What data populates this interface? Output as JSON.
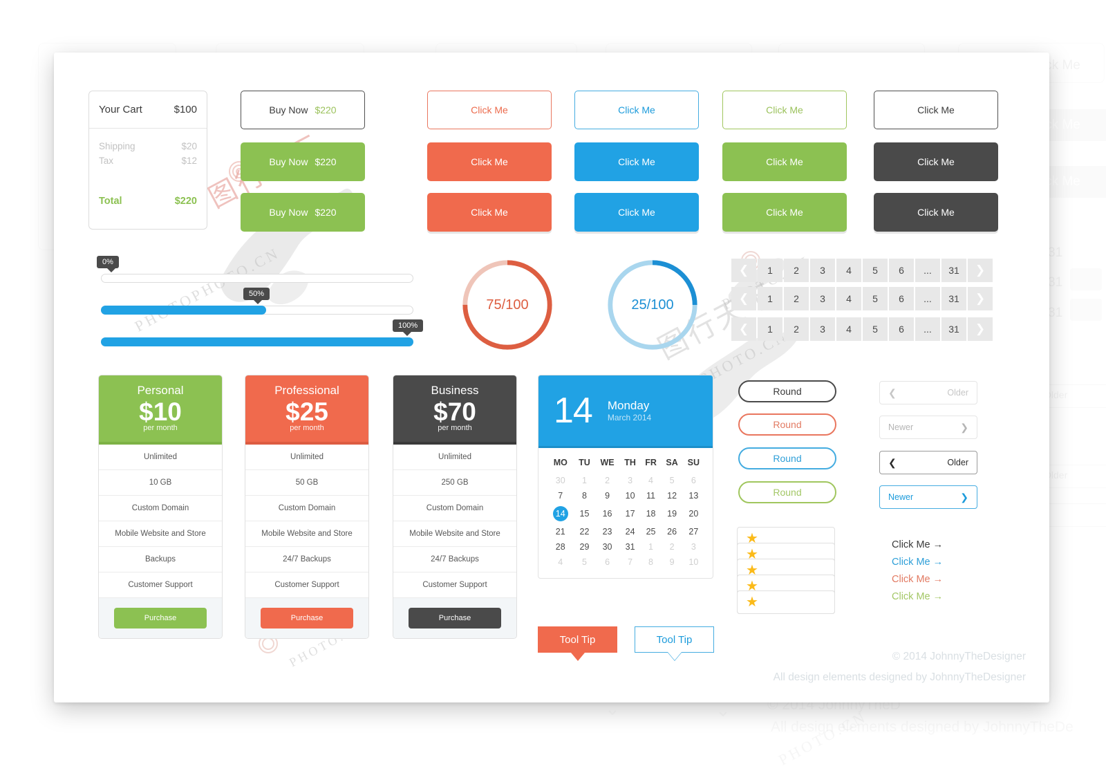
{
  "cart": {
    "title": "Your Cart",
    "total_amount": "$100",
    "rows": [
      {
        "label": "Shipping",
        "value": "$20"
      },
      {
        "label": "Tax",
        "value": "$12"
      }
    ],
    "total_label": "Total",
    "total_value": "$220"
  },
  "buy_buttons": [
    {
      "label": "Buy Now",
      "price": "$220",
      "style": "outline"
    },
    {
      "label": "Buy Now",
      "price": "$220",
      "style": "solid-green"
    },
    {
      "label": "Buy Now",
      "price": "$220",
      "style": "solid-green"
    }
  ],
  "click_buttons": {
    "label": "Click Me",
    "columns": [
      {
        "color_name": "red",
        "hex": "#F06A4D",
        "outline_text": "#EC6B4D"
      },
      {
        "color_name": "blue",
        "hex": "#21A2E4",
        "outline_text": "#1C9BDB"
      },
      {
        "color_name": "green",
        "hex": "#8CC152",
        "outline_text": "#9BC25C"
      },
      {
        "color_name": "dark",
        "hex": "#4A4A4A",
        "outline_text": "#3B3B3B"
      }
    ]
  },
  "sliders": [
    {
      "label": "0%",
      "value": 0
    },
    {
      "label": "50%",
      "value": 50
    },
    {
      "label": "100%",
      "value": 100
    }
  ],
  "donuts": [
    {
      "value": "75/100",
      "percent": 75,
      "color": "#DD5E41",
      "track": "#EFC5B9"
    },
    {
      "value": "25/100",
      "percent": 25,
      "color": "#1C8FD4",
      "track": "#A9D6EE"
    }
  ],
  "pagination": {
    "pages": [
      "1",
      "2",
      "3",
      "4",
      "5",
      "6",
      "...",
      "31"
    ],
    "prev_icon": "chevron-left-icon",
    "next_icon": "chevron-right-icon",
    "rows": [
      {
        "accent": "#4A4A4A"
      },
      {
        "accent": "#21A2E4"
      },
      {
        "accent": "#8CC152"
      }
    ]
  },
  "plans": [
    {
      "name": "Personal",
      "price": "$10",
      "per": "per month",
      "accent": "#8CC152",
      "features": [
        "Unlimited",
        "10 GB",
        "Custom Domain",
        "Mobile Website and Store",
        "Backups",
        "Customer Support"
      ],
      "cta": "Purchase"
    },
    {
      "name": "Professional",
      "price": "$25",
      "per": "per month",
      "accent": "#F06A4D",
      "features": [
        "Unlimited",
        "50 GB",
        "Custom Domain",
        "Mobile Website and Store",
        "24/7 Backups",
        "Customer Support"
      ],
      "cta": "Purchase"
    },
    {
      "name": "Business",
      "price": "$70",
      "per": "per month",
      "accent": "#4A4A4A",
      "features": [
        "Unlimited",
        "250 GB",
        "Custom Domain",
        "Mobile Website and Store",
        "24/7 Backups",
        "Customer Support"
      ],
      "cta": "Purchase"
    }
  ],
  "calendar": {
    "day": "14",
    "weekday": "Monday",
    "month_year": "March 2014",
    "weekday_headers": [
      "MO",
      "TU",
      "WE",
      "TH",
      "FR",
      "SA",
      "SU"
    ],
    "weeks": [
      [
        {
          "d": "30",
          "m": true
        },
        {
          "d": "1",
          "m": true
        },
        {
          "d": "2",
          "m": true
        },
        {
          "d": "3",
          "m": true
        },
        {
          "d": "4",
          "m": true
        },
        {
          "d": "5",
          "m": true
        },
        {
          "d": "6",
          "m": true
        }
      ],
      [
        {
          "d": "7"
        },
        {
          "d": "8"
        },
        {
          "d": "9"
        },
        {
          "d": "10"
        },
        {
          "d": "11"
        },
        {
          "d": "12"
        },
        {
          "d": "13"
        }
      ],
      [
        {
          "d": "14",
          "sel": true
        },
        {
          "d": "15"
        },
        {
          "d": "16"
        },
        {
          "d": "17"
        },
        {
          "d": "18"
        },
        {
          "d": "19"
        },
        {
          "d": "20"
        }
      ],
      [
        {
          "d": "21"
        },
        {
          "d": "22"
        },
        {
          "d": "23"
        },
        {
          "d": "24"
        },
        {
          "d": "25"
        },
        {
          "d": "26"
        },
        {
          "d": "27"
        }
      ],
      [
        {
          "d": "28"
        },
        {
          "d": "29"
        },
        {
          "d": "30"
        },
        {
          "d": "31"
        },
        {
          "d": "1",
          "m": true
        },
        {
          "d": "2",
          "m": true
        },
        {
          "d": "3",
          "m": true
        }
      ],
      [
        {
          "d": "4",
          "m": true
        },
        {
          "d": "5",
          "m": true
        },
        {
          "d": "6",
          "m": true
        },
        {
          "d": "7",
          "m": true
        },
        {
          "d": "8",
          "m": true
        },
        {
          "d": "9",
          "m": true
        },
        {
          "d": "10",
          "m": true
        }
      ]
    ]
  },
  "round_buttons": [
    {
      "label": "Round",
      "color": "#3B3B3B",
      "border": "#4A4A4A"
    },
    {
      "label": "Round",
      "color": "#E27A62",
      "border": "#E9765E"
    },
    {
      "label": "Round",
      "color": "#2E9FD8",
      "border": "#44ACE0"
    },
    {
      "label": "Round",
      "color": "#A3C766",
      "border": "#A0C65E"
    }
  ],
  "nav_buttons": [
    {
      "label": "Older",
      "dir": "prev",
      "text": "#c0c0c0",
      "border": "#e0e0e0",
      "chev": "chevron-left-icon"
    },
    {
      "label": "Newer",
      "dir": "next",
      "text": "#b5b5b5",
      "border": "#e0e0e0",
      "chev": "chevron-right-icon"
    },
    {
      "label": "Older",
      "dir": "prev",
      "text": "#2b2b2b",
      "border": "#9a9a9a",
      "chev": "chevron-left-icon"
    },
    {
      "label": "Newer",
      "dir": "next",
      "text": "#1C9BDB",
      "border": "#44ACE0",
      "chev": "chevron-right-icon"
    }
  ],
  "star_rows": [
    1,
    2,
    3,
    4,
    5
  ],
  "star_total": 5,
  "star_on_color": "#FBBA19",
  "star_off_color": "#E2E2E2",
  "arrow_links": [
    {
      "label": "Click Me",
      "arrow": "→",
      "color": "#3B3B3B"
    },
    {
      "label": "Click Me",
      "arrow": "→",
      "color": "#2E9FD8"
    },
    {
      "label": "Click Me",
      "arrow": "→",
      "color": "#E27A62"
    },
    {
      "label": "Click Me",
      "arrow": "→",
      "color": "#A3C766"
    }
  ],
  "tooltips": [
    {
      "label": "Tool Tip",
      "style": "solid"
    },
    {
      "label": "Tool Tip",
      "style": "outline"
    }
  ],
  "footer": {
    "copyright": "© 2014 JohnnyTheDesigner",
    "credit": "All design elements designed by JohnnyTheDesigner"
  },
  "background": {
    "ghost_label": "Click Me",
    "ghost_numbers": [
      "31",
      "31",
      "31"
    ],
    "ghost_older": "Older",
    "ghost_credit": "All design elements designed by JohnnyTheDe"
  },
  "watermark": {
    "line1": "PHOTOPHOTO.CN",
    "line2": "图行天下",
    "line3": "PHOTO.CN"
  }
}
